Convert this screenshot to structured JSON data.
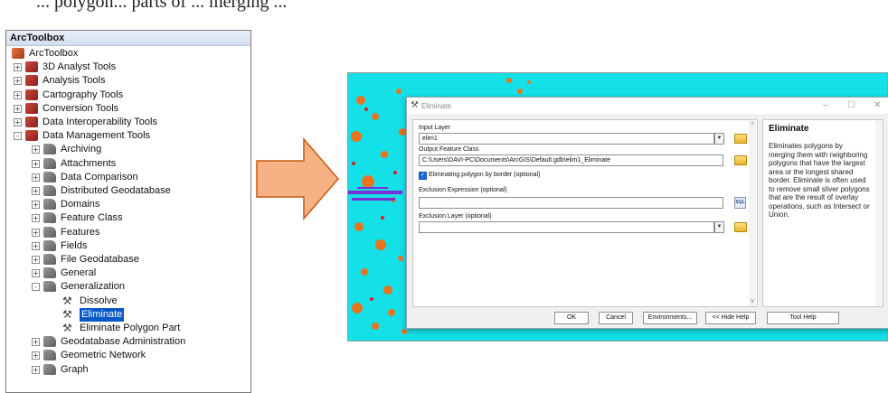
{
  "caption": "... polygon... parts of ... merging ...",
  "arctoolbox": {
    "title": "ArcToolbox",
    "items": [
      {
        "label": "ArcToolbox",
        "icon": "arctoolbox-icon",
        "level": 0,
        "expander": ""
      },
      {
        "label": "3D Analyst Tools",
        "icon": "toolbox-icon",
        "level": 1,
        "expander": "+"
      },
      {
        "label": "Analysis Tools",
        "icon": "toolbox-icon",
        "level": 1,
        "expander": "+"
      },
      {
        "label": "Cartography Tools",
        "icon": "toolbox-icon",
        "level": 1,
        "expander": "+"
      },
      {
        "label": "Conversion Tools",
        "icon": "toolbox-icon",
        "level": 1,
        "expander": "+"
      },
      {
        "label": "Data Interoperability Tools",
        "icon": "toolbox-icon",
        "level": 1,
        "expander": "+"
      },
      {
        "label": "Data Management Tools",
        "icon": "toolbox-icon",
        "level": 1,
        "expander": "-"
      },
      {
        "label": "Archiving",
        "icon": "toolset-icon",
        "level": 2,
        "expander": "+"
      },
      {
        "label": "Attachments",
        "icon": "toolset-icon",
        "level": 2,
        "expander": "+"
      },
      {
        "label": "Data Comparison",
        "icon": "toolset-icon",
        "level": 2,
        "expander": "+"
      },
      {
        "label": "Distributed Geodatabase",
        "icon": "toolset-icon",
        "level": 2,
        "expander": "+"
      },
      {
        "label": "Domains",
        "icon": "toolset-icon",
        "level": 2,
        "expander": "+"
      },
      {
        "label": "Feature Class",
        "icon": "toolset-icon",
        "level": 2,
        "expander": "+"
      },
      {
        "label": "Features",
        "icon": "toolset-icon",
        "level": 2,
        "expander": "+"
      },
      {
        "label": "Fields",
        "icon": "toolset-icon",
        "level": 2,
        "expander": "+"
      },
      {
        "label": "File Geodatabase",
        "icon": "toolset-icon",
        "level": 2,
        "expander": "+"
      },
      {
        "label": "General",
        "icon": "toolset-icon",
        "level": 2,
        "expander": "+"
      },
      {
        "label": "Generalization",
        "icon": "toolset-icon",
        "level": 2,
        "expander": "-"
      },
      {
        "label": "Dissolve",
        "icon": "hammer-icon",
        "level": 3,
        "expander": ""
      },
      {
        "label": "Eliminate",
        "icon": "hammer-icon",
        "level": 3,
        "expander": "",
        "selected": true
      },
      {
        "label": "Eliminate Polygon Part",
        "icon": "hammer-icon",
        "level": 3,
        "expander": ""
      },
      {
        "label": "Geodatabase Administration",
        "icon": "toolset-icon",
        "level": 2,
        "expander": "+"
      },
      {
        "label": "Geometric Network",
        "icon": "toolset-icon",
        "level": 2,
        "expander": "+"
      },
      {
        "label": "Graph",
        "icon": "toolset-icon",
        "level": 2,
        "expander": "+"
      }
    ]
  },
  "dialog": {
    "title": "Eliminate",
    "window_controls": [
      "–",
      "☐",
      "✕"
    ],
    "input_layer_label": "Input Layer",
    "input_layer_value": "elim1",
    "output_label": "Output Feature Class",
    "output_value": "C:\\Users\\DAVI-PC\\Documents\\ArcGIS\\Default.gdb\\elim1_Eliminate",
    "checkbox_label": "Eliminating polygon by border (optional)",
    "checkbox_checked": true,
    "exclusion_expr_label": "Exclusion Expression (optional)",
    "exclusion_expr_value": "",
    "sql_label": "SQL",
    "exclusion_layer_label": "Exclusion Layer (optional)",
    "exclusion_layer_value": "",
    "help_title": "Eliminate",
    "help_text": "Eliminates polygons by merging them with neighboring polygons that have the largest area or the longest shared border. Eliminate is often used to remove small sliver polygons that are the result of overlay operations, such as Intersect or Union.",
    "buttons": {
      "ok": "OK",
      "cancel": "Cancel",
      "environments": "Environments...",
      "hide_help": "<< Hide Help",
      "tool_help": "Tool Help"
    }
  },
  "colors": {
    "arrow_fill": "#f4b183",
    "arrow_stroke": "#c55a11",
    "selection": "#0a57c7",
    "map_cyan": "#14e0e8",
    "map_orange": "#e8741e",
    "map_red": "#d42323",
    "map_purple": "#7b2fd6"
  }
}
